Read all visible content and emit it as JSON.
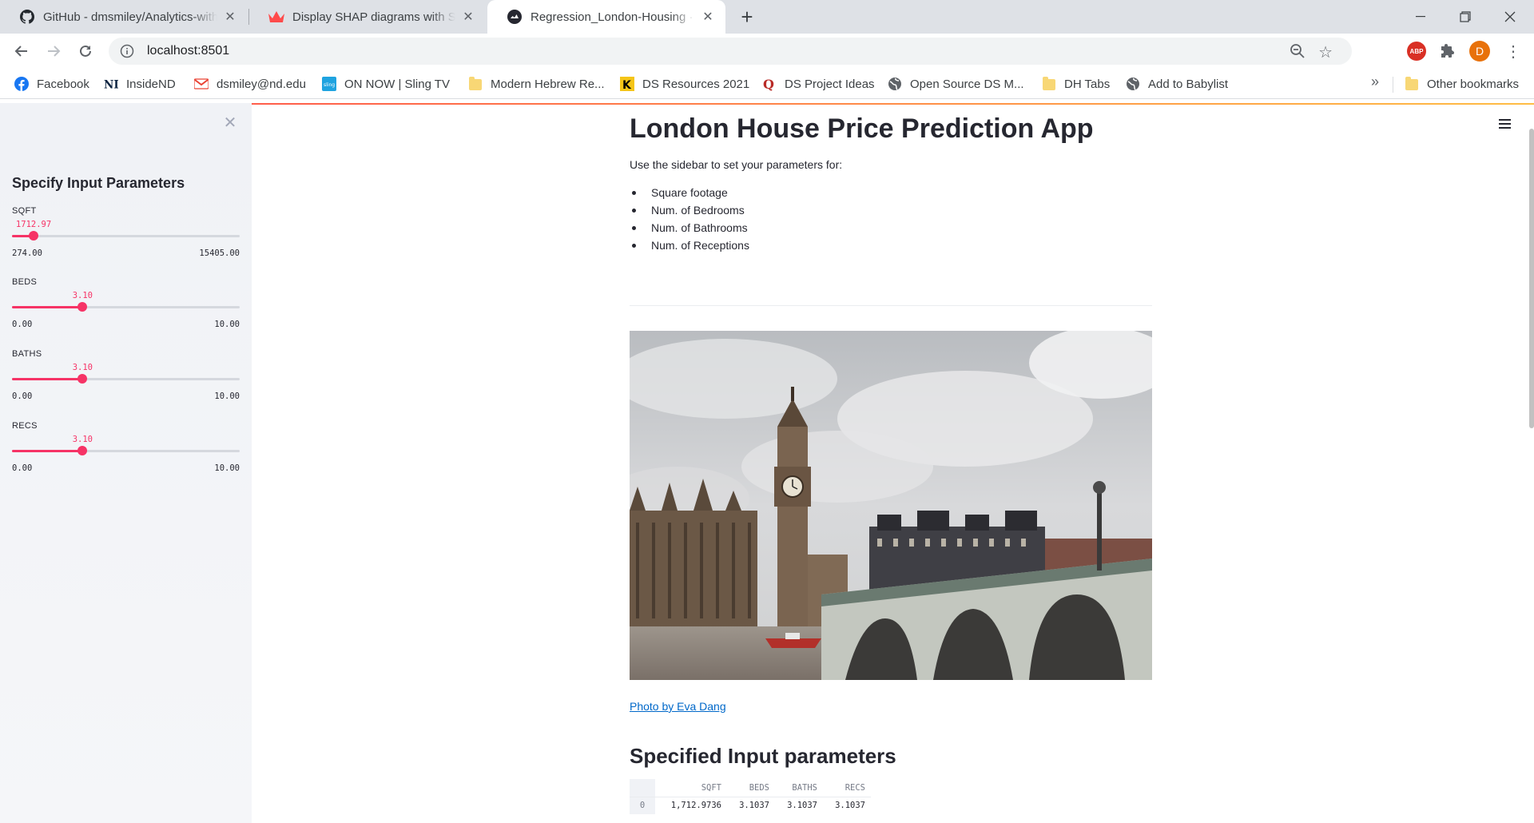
{
  "browser": {
    "tabs": [
      {
        "title": "GitHub - dmsmiley/Analytics-with-Streamlit",
        "icon": "github-icon",
        "active": false
      },
      {
        "title": "Display SHAP diagrams with Streamlit",
        "icon": "streamlit-crown-icon",
        "active": false
      },
      {
        "title": "Regression_London-Housing · Streamlit",
        "icon": "streamlit-icon",
        "active": true
      }
    ],
    "url": "localhost:8501",
    "avatar_letter": "D",
    "extension_abp": "ABP",
    "bookmarks": [
      {
        "label": "Facebook",
        "icon": "facebook-icon"
      },
      {
        "label": "InsideND",
        "icon": "notre-dame-icon"
      },
      {
        "label": "dsmiley@nd.edu",
        "icon": "gmail-icon"
      },
      {
        "label": "ON NOW | Sling TV",
        "icon": "sling-icon"
      },
      {
        "label": "Modern Hebrew Re...",
        "icon": "folder-icon"
      },
      {
        "label": "DS Resources 2021",
        "icon": "k-icon"
      },
      {
        "label": "DS Project Ideas",
        "icon": "quora-icon"
      },
      {
        "label": "Open Source DS M...",
        "icon": "globe-icon"
      },
      {
        "label": "DH Tabs",
        "icon": "folder-icon"
      },
      {
        "label": "Add to Babylist",
        "icon": "globe-icon"
      }
    ],
    "more_bookmarks": "»",
    "other_bookmarks": "Other bookmarks"
  },
  "sidebar": {
    "title": "Specify Input Parameters",
    "sliders": [
      {
        "label": "SQFT",
        "value": "1712.97",
        "min": "274.00",
        "max": "15405.00",
        "fraction": 0.095
      },
      {
        "label": "BEDS",
        "value": "3.10",
        "min": "0.00",
        "max": "10.00",
        "fraction": 0.31
      },
      {
        "label": "BATHS",
        "value": "3.10",
        "min": "0.00",
        "max": "10.00",
        "fraction": 0.31
      },
      {
        "label": "RECS",
        "value": "3.10",
        "min": "0.00",
        "max": "10.00",
        "fraction": 0.31
      }
    ]
  },
  "main": {
    "title": "London House Price Prediction App",
    "intro": "Use the sidebar to set your parameters for:",
    "params": [
      "Square footage",
      "Num. of Bedrooms",
      "Num. of Bathrooms",
      "Num. of Receptions"
    ],
    "photo_credit": "Photo by Eva Dang",
    "subheader": "Specified Input parameters",
    "table": {
      "columns": [
        "SQFT",
        "BEDS",
        "BATHS",
        "RECS"
      ],
      "rows": [
        {
          "index": "0",
          "cells": [
            "1,712.9736",
            "3.1037",
            "3.1037",
            "3.1037"
          ]
        }
      ]
    }
  },
  "colors": {
    "accent": "#f63366",
    "sidebar_bg": "#f0f2f6",
    "link": "#0068c9"
  }
}
